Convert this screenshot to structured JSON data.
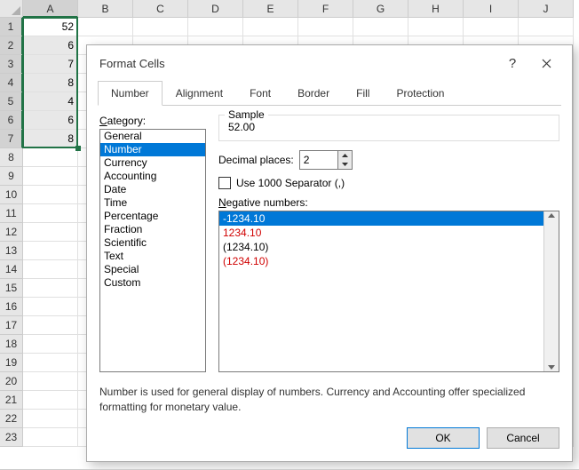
{
  "columns": [
    "A",
    "B",
    "C",
    "D",
    "E",
    "F",
    "G",
    "H",
    "I",
    "J"
  ],
  "row_count": 23,
  "cells": {
    "A1": "52",
    "A2": "6",
    "A3": "7",
    "A4": "8",
    "A5": "4",
    "A6": "6",
    "A7": "8"
  },
  "selected_col": "A",
  "selected_rows_start": 1,
  "selected_rows_end": 7,
  "dialog": {
    "title": "Format Cells",
    "help_glyph": "?",
    "tabs": [
      "Number",
      "Alignment",
      "Font",
      "Border",
      "Fill",
      "Protection"
    ],
    "active_tab": 0,
    "category_label_pre": "",
    "category_label_u": "C",
    "category_label_post": "ategory:",
    "categories": [
      "General",
      "Number",
      "Currency",
      "Accounting",
      "Date",
      "Time",
      "Percentage",
      "Fraction",
      "Scientific",
      "Text",
      "Special",
      "Custom"
    ],
    "category_selected": 1,
    "sample_label": "Sample",
    "sample_value": "52.00",
    "decimal_label_u": "D",
    "decimal_label_post": "ecimal places:",
    "decimal_value": "2",
    "sep_label_u": "U",
    "sep_label_post": "se 1000 Separator (,)",
    "neg_label_u": "N",
    "neg_label_post": "egative numbers:",
    "neg_options": [
      {
        "text": "-1234.10",
        "red": false,
        "sel": true
      },
      {
        "text": "1234.10",
        "red": true,
        "sel": false
      },
      {
        "text": "(1234.10)",
        "red": false,
        "sel": false
      },
      {
        "text": "(1234.10)",
        "red": true,
        "sel": false
      }
    ],
    "description": "Number is used for general display of numbers.  Currency and Accounting offer specialized formatting for monetary value.",
    "ok": "OK",
    "cancel": "Cancel"
  }
}
